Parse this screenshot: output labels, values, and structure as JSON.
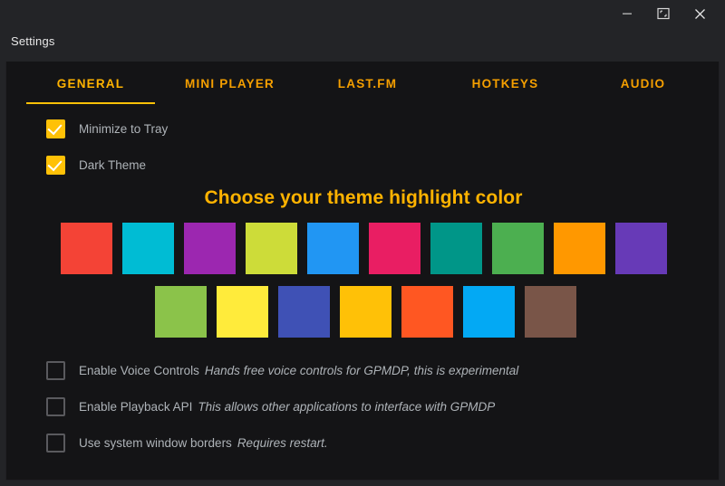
{
  "window": {
    "title": "Settings",
    "controls": [
      {
        "name": "minimize",
        "glyph": "minimize-icon"
      },
      {
        "name": "maximize",
        "glyph": "maximize-icon"
      },
      {
        "name": "close",
        "glyph": "close-icon"
      }
    ]
  },
  "tabs": [
    {
      "label": "GENERAL",
      "active": true
    },
    {
      "label": "MINI PLAYER",
      "active": false
    },
    {
      "label": "LAST.FM",
      "active": false
    },
    {
      "label": "HOTKEYS",
      "active": false
    },
    {
      "label": "AUDIO",
      "active": false
    }
  ],
  "top_options": [
    {
      "label": "Minimize to Tray",
      "checked": true
    },
    {
      "label": "Dark Theme",
      "checked": true
    }
  ],
  "theme": {
    "heading": "Choose your theme highlight color",
    "row1": [
      "#f44336",
      "#00bcd4",
      "#9c27b0",
      "#cddc39",
      "#2196f3",
      "#e91e63",
      "#009688",
      "#4caf50",
      "#ff9800",
      "#673ab7"
    ],
    "row2": [
      "#8bc34a",
      "#ffeb3b",
      "#3f51b5",
      "#ffc107",
      "#ff5722",
      "#03a9f4",
      "#795548"
    ]
  },
  "bottom_options": [
    {
      "label": "Enable Voice Controls",
      "description": "Hands free voice controls for GPMDP, this is experimental",
      "checked": false
    },
    {
      "label": "Enable Playback API",
      "description": "This allows other applications to interface with GPMDP",
      "checked": false
    },
    {
      "label": "Use system window borders",
      "description": "Requires restart.",
      "checked": false
    }
  ],
  "colors": {
    "accent": "#ffc107",
    "tab_text": "#f59f00",
    "titlebar_bg": "#232427",
    "content_bg": "#141416",
    "label_text": "#aeb3b8"
  }
}
